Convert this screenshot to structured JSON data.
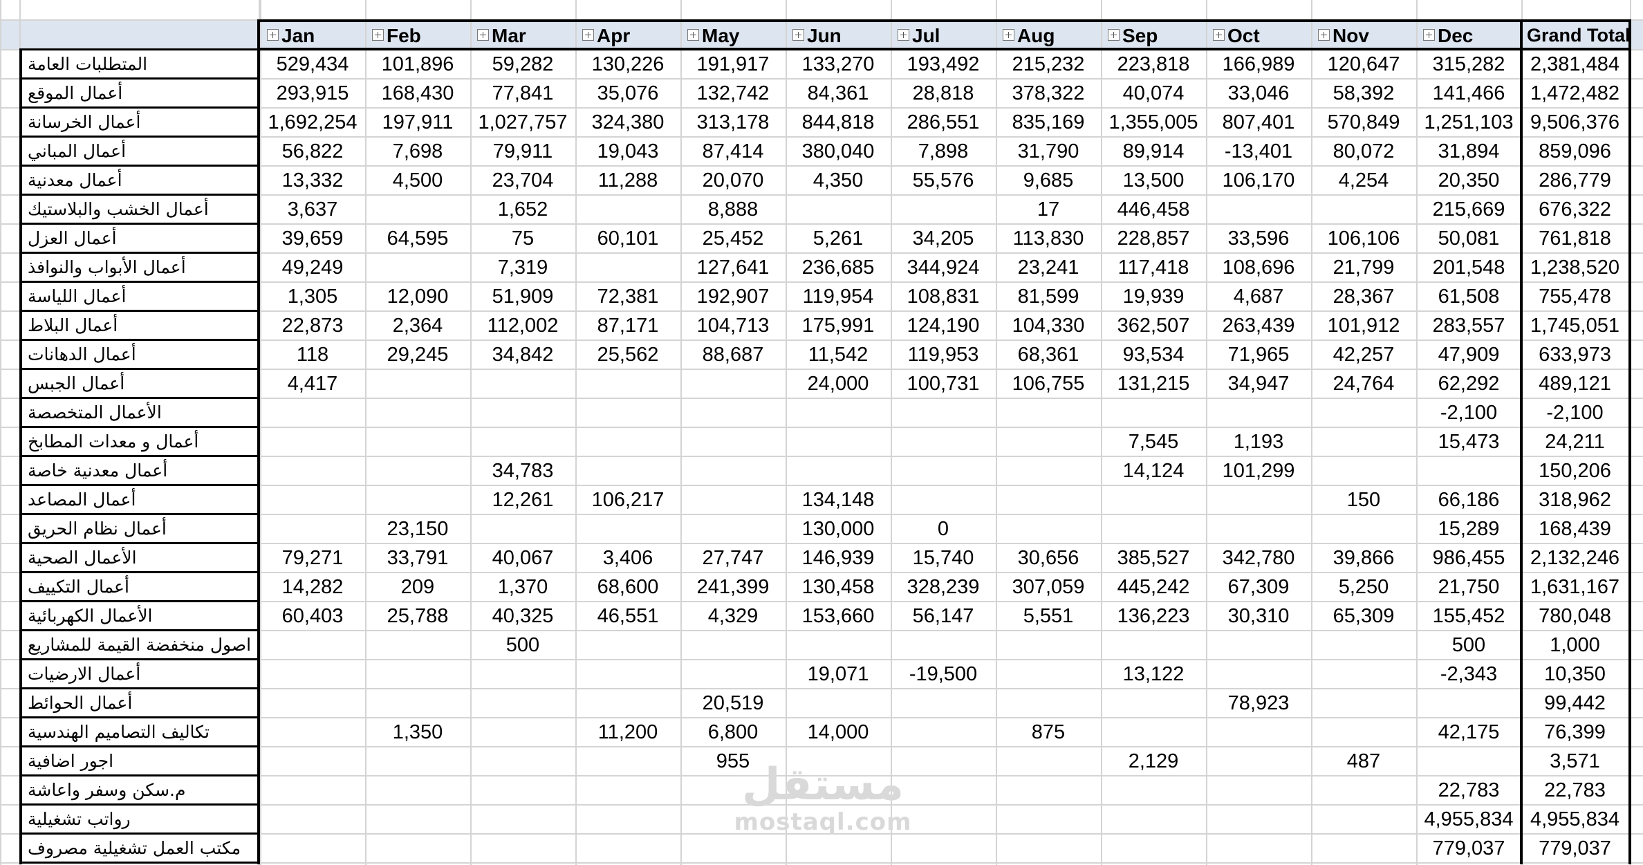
{
  "header": {
    "months": [
      "Jan",
      "Feb",
      "Mar",
      "Apr",
      "May",
      "Jun",
      "Jul",
      "Aug",
      "Sep",
      "Oct",
      "Nov",
      "Dec"
    ],
    "grand_total": "Grand Total"
  },
  "rows": [
    {
      "label": "المتطلبات العامة",
      "values": [
        "529,434",
        "101,896",
        "59,282",
        "130,226",
        "191,917",
        "133,270",
        "193,492",
        "215,232",
        "223,818",
        "166,989",
        "120,647",
        "315,282"
      ],
      "total": "2,381,484"
    },
    {
      "label": "أعمال الموقع",
      "values": [
        "293,915",
        "168,430",
        "77,841",
        "35,076",
        "132,742",
        "84,361",
        "28,818",
        "378,322",
        "40,074",
        "33,046",
        "58,392",
        "141,466"
      ],
      "total": "1,472,482"
    },
    {
      "label": "أعمال الخرسانة",
      "values": [
        "1,692,254",
        "197,911",
        "1,027,757",
        "324,380",
        "313,178",
        "844,818",
        "286,551",
        "835,169",
        "1,355,005",
        "807,401",
        "570,849",
        "1,251,103"
      ],
      "total": "9,506,376"
    },
    {
      "label": "أعمال المباني",
      "values": [
        "56,822",
        "7,698",
        "79,911",
        "19,043",
        "87,414",
        "380,040",
        "7,898",
        "31,790",
        "89,914",
        "-13,401",
        "80,072",
        "31,894"
      ],
      "total": "859,096"
    },
    {
      "label": "أعمال معدنية",
      "values": [
        "13,332",
        "4,500",
        "23,704",
        "11,288",
        "20,070",
        "4,350",
        "55,576",
        "9,685",
        "13,500",
        "106,170",
        "4,254",
        "20,350"
      ],
      "total": "286,779"
    },
    {
      "label": "أعمال الخشب والبلاستيك",
      "values": [
        "3,637",
        "",
        "1,652",
        "",
        "8,888",
        "",
        "",
        "17",
        "446,458",
        "",
        "",
        "215,669"
      ],
      "total": "676,322"
    },
    {
      "label": "أعمال العزل",
      "values": [
        "39,659",
        "64,595",
        "75",
        "60,101",
        "25,452",
        "5,261",
        "34,205",
        "113,830",
        "228,857",
        "33,596",
        "106,106",
        "50,081"
      ],
      "total": "761,818"
    },
    {
      "label": "أعمال الأبواب والنوافذ",
      "values": [
        "49,249",
        "",
        "7,319",
        "",
        "127,641",
        "236,685",
        "344,924",
        "23,241",
        "117,418",
        "108,696",
        "21,799",
        "201,548"
      ],
      "total": "1,238,520"
    },
    {
      "label": "أعمال اللياسة",
      "values": [
        "1,305",
        "12,090",
        "51,909",
        "72,381",
        "192,907",
        "119,954",
        "108,831",
        "81,599",
        "19,939",
        "4,687",
        "28,367",
        "61,508"
      ],
      "total": "755,478"
    },
    {
      "label": "أعمال البلاط",
      "values": [
        "22,873",
        "2,364",
        "112,002",
        "87,171",
        "104,713",
        "175,991",
        "124,190",
        "104,330",
        "362,507",
        "263,439",
        "101,912",
        "283,557"
      ],
      "total": "1,745,051"
    },
    {
      "label": "أعمال الدهانات",
      "values": [
        "118",
        "29,245",
        "34,842",
        "25,562",
        "88,687",
        "11,542",
        "119,953",
        "68,361",
        "93,534",
        "71,965",
        "42,257",
        "47,909"
      ],
      "total": "633,973"
    },
    {
      "label": "أعمال الجبس",
      "values": [
        "4,417",
        "",
        "",
        "",
        "",
        "24,000",
        "100,731",
        "106,755",
        "131,215",
        "34,947",
        "24,764",
        "62,292"
      ],
      "total": "489,121"
    },
    {
      "label": "الأعمال المتخصصة",
      "values": [
        "",
        "",
        "",
        "",
        "",
        "",
        "",
        "",
        "",
        "",
        "",
        "-2,100"
      ],
      "total": "-2,100"
    },
    {
      "label": "أعمال و معدات المطابخ",
      "values": [
        "",
        "",
        "",
        "",
        "",
        "",
        "",
        "",
        "7,545",
        "1,193",
        "",
        "15,473"
      ],
      "total": "24,211"
    },
    {
      "label": "أعمال معدنية خاصة",
      "values": [
        "",
        "",
        "34,783",
        "",
        "",
        "",
        "",
        "",
        "14,124",
        "101,299",
        "",
        ""
      ],
      "total": "150,206"
    },
    {
      "label": "أعمال المصاعد",
      "values": [
        "",
        "",
        "12,261",
        "106,217",
        "",
        "134,148",
        "",
        "",
        "",
        "",
        "150",
        "66,186"
      ],
      "total": "318,962"
    },
    {
      "label": "أعمال نظام الحريق",
      "values": [
        "",
        "23,150",
        "",
        "",
        "",
        "130,000",
        "0",
        "",
        "",
        "",
        "",
        "15,289"
      ],
      "total": "168,439"
    },
    {
      "label": "الأعمال الصحية",
      "values": [
        "79,271",
        "33,791",
        "40,067",
        "3,406",
        "27,747",
        "146,939",
        "15,740",
        "30,656",
        "385,527",
        "342,780",
        "39,866",
        "986,455"
      ],
      "total": "2,132,246"
    },
    {
      "label": "أعمال التكييف",
      "values": [
        "14,282",
        "209",
        "1,370",
        "68,600",
        "241,399",
        "130,458",
        "328,239",
        "307,059",
        "445,242",
        "67,309",
        "5,250",
        "21,750"
      ],
      "total": "1,631,167"
    },
    {
      "label": "الأعمال الكهربائية",
      "values": [
        "60,403",
        "25,788",
        "40,325",
        "46,551",
        "4,329",
        "153,660",
        "56,147",
        "5,551",
        "136,223",
        "30,310",
        "65,309",
        "155,452"
      ],
      "total": "780,048"
    },
    {
      "label": "اصول منخفضة القيمة للمشاريع",
      "values": [
        "",
        "",
        "500",
        "",
        "",
        "",
        "",
        "",
        "",
        "",
        "",
        "500"
      ],
      "total": "1,000"
    },
    {
      "label": "أعمال الارضيات",
      "values": [
        "",
        "",
        "",
        "",
        "",
        "19,071",
        "-19,500",
        "",
        "13,122",
        "",
        "",
        "-2,343"
      ],
      "total": "10,350"
    },
    {
      "label": "أعمال الحوائط",
      "values": [
        "",
        "",
        "",
        "",
        "20,519",
        "",
        "",
        "",
        "",
        "78,923",
        "",
        ""
      ],
      "total": "99,442"
    },
    {
      "label": "تكاليف التصاميم الهندسية",
      "values": [
        "",
        "1,350",
        "",
        "11,200",
        "6,800",
        "14,000",
        "",
        "875",
        "",
        "",
        "",
        "42,175"
      ],
      "total": "76,399"
    },
    {
      "label": "اجور اضافية",
      "values": [
        "",
        "",
        "",
        "",
        "955",
        "",
        "",
        "",
        "2,129",
        "",
        "487",
        ""
      ],
      "total": "3,571"
    },
    {
      "label": "م.سكن وسفر واعاشة",
      "values": [
        "",
        "",
        "",
        "",
        "",
        "",
        "",
        "",
        "",
        "",
        "",
        "22,783"
      ],
      "total": "22,783"
    },
    {
      "label": "رواتب تشغيلية",
      "values": [
        "",
        "",
        "",
        "",
        "",
        "",
        "",
        "",
        "",
        "",
        "",
        "4,955,834"
      ],
      "total": "4,955,834"
    },
    {
      "label": "مكتب العمل تشغيلية مصروف",
      "values": [
        "",
        "",
        "",
        "",
        "",
        "",
        "",
        "",
        "",
        "",
        "",
        "779,037"
      ],
      "total": "779,037"
    }
  ],
  "watermark": {
    "arabic": "مستقل",
    "latin": "mostaql.com"
  },
  "colors": {
    "header_band": "#dde5f0",
    "gridline": "#d4d4d4",
    "rule": "#000000",
    "watermark": "#d9d9d9"
  },
  "icons": {
    "month_header": "expand-plus-icon"
  }
}
